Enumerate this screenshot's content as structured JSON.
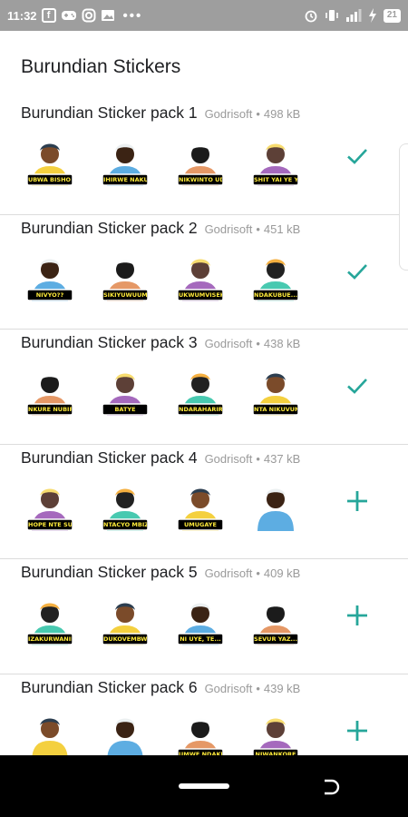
{
  "status_bar": {
    "time": "11:32",
    "notification_icons": [
      "facebook-icon",
      "gamepad-icon",
      "instagram-icon",
      "image-icon"
    ],
    "more": "•••",
    "battery": "21"
  },
  "app": {
    "title": "Burundian Stickers"
  },
  "packs": [
    {
      "name": "Burundian Sticker pack 1",
      "publisher": "Godrisoft",
      "size": "498 kB",
      "action": "added",
      "stickers": [
        {
          "caption": "UBWA BISHO BYE..."
        },
        {
          "caption": "IHIRWE NAKUBWIWE"
        },
        {
          "caption": "NIKWINTO UDWE"
        },
        {
          "caption": "SHIT YAI YE YUU"
        }
      ]
    },
    {
      "name": "Burundian Sticker pack 2",
      "publisher": "Godrisoft",
      "size": "451 kB",
      "action": "added",
      "stickers": [
        {
          "caption": "NIVYO??"
        },
        {
          "caption": "SIKIYUWUUMENYA"
        },
        {
          "caption": "UKWUMVISEKO"
        },
        {
          "caption": "NDAKUBUE... EYE"
        }
      ]
    },
    {
      "name": "Burundian Sticker pack 3",
      "publisher": "Godrisoft",
      "size": "438 kB",
      "action": "added",
      "stickers": [
        {
          "caption": "NKURE NUBIRI"
        },
        {
          "caption": "BATYE"
        },
        {
          "caption": "NDARAHARIRA"
        },
        {
          "caption": "NTA NIKUVUNYE IYE..."
        }
      ]
    },
    {
      "name": "Burundian Sticker pack 4",
      "publisher": "Godrisoft",
      "size": "437 kB",
      "action": "add",
      "stickers": [
        {
          "caption": "HOPE NTE SUREDE ??"
        },
        {
          "caption": "NTACYO MBIZI"
        },
        {
          "caption": "UMUGAYE"
        },
        {
          "caption": ""
        }
      ]
    },
    {
      "name": "Burundian Sticker pack 5",
      "publisher": "Godrisoft",
      "size": "409 kB",
      "action": "add",
      "stickers": [
        {
          "caption": "IZAKURWANIRE KIGORE ??"
        },
        {
          "caption": "DUKOVEMBWA GUSA !!"
        },
        {
          "caption": "NI UYE, TE..."
        },
        {
          "caption": "SEVUR YAZ..."
        }
      ]
    },
    {
      "name": "Burundian Sticker pack 6",
      "publisher": "Godrisoft",
      "size": "439 kB",
      "action": "add",
      "stickers": [
        {
          "caption": ""
        },
        {
          "caption": ""
        },
        {
          "caption": "UMWE NDAKUZI"
        },
        {
          "caption": "NIWANKORE"
        }
      ]
    }
  ],
  "colors": {
    "accent": "#26a69a",
    "status_bar": "#9e9e9e",
    "divider": "#dcdcdc",
    "meta_text": "#9a9a9a"
  }
}
